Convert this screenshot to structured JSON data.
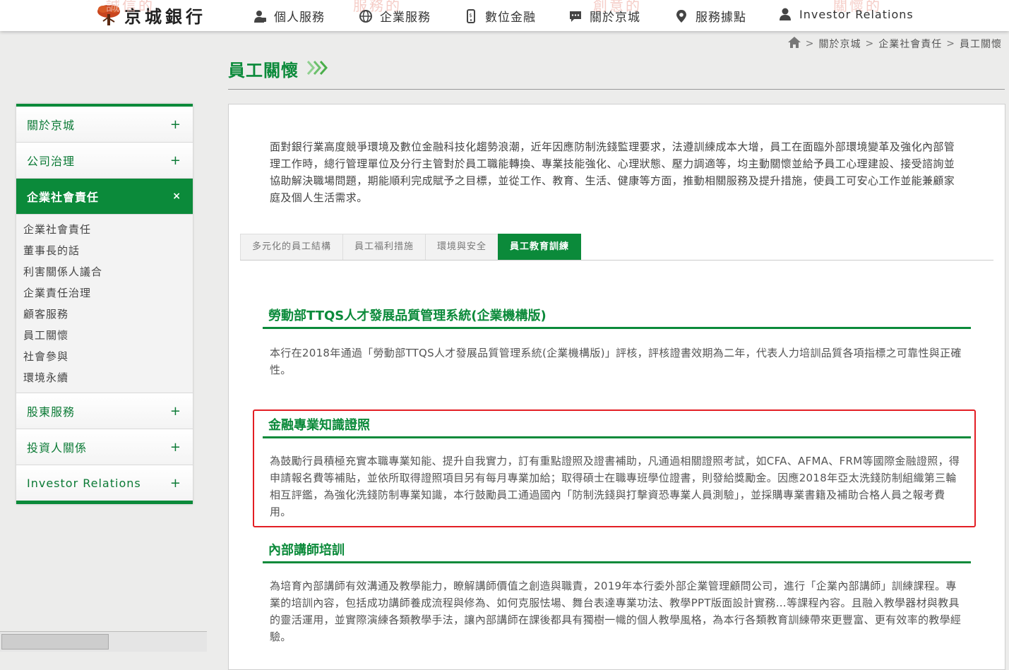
{
  "header": {
    "logo_text": "京城銀行",
    "nav": [
      {
        "label": "個人服務",
        "icon": "person-icon"
      },
      {
        "label": "企業服務",
        "icon": "globe-icon"
      },
      {
        "label": "數位金融",
        "icon": "phone-icon"
      },
      {
        "label": "關於京城",
        "icon": "chat-icon"
      },
      {
        "label": "服務據點",
        "icon": "location-pin-icon"
      },
      {
        "label": "Investor Relations",
        "icon": "user-icon"
      }
    ]
  },
  "breadcrumb": [
    "關於京城",
    "企業社會責任",
    "員工關懷"
  ],
  "page_title": "員工關懷",
  "sidebar": {
    "items": [
      {
        "label": "關於京城",
        "toggle": "+"
      },
      {
        "label": "公司治理",
        "toggle": "+"
      },
      {
        "label": "企業社會責任",
        "toggle": "×"
      },
      {
        "label": "股東服務",
        "toggle": "+"
      },
      {
        "label": "投資人關係",
        "toggle": "+"
      },
      {
        "label": "Investor Relations",
        "toggle": "+"
      }
    ],
    "submenu": [
      "企業社會責任",
      "董事長的話",
      "利害關係人議合",
      "企業責任治理",
      "顧客服務",
      "員工關懷",
      "社會參與",
      "環境永續"
    ]
  },
  "intro": "面對銀行業高度競爭環境及數位金融科技化趨勢浪潮，近年因應防制洗錢監理要求，法遵訓練成本大增，員工在面臨外部環境變革及強化內部管理工作時，總行管理單位及分行主管對於員工職能轉換、專業技能強化、心理狀態、壓力調適等，均主動關懷並給予員工心理建設、接受諮詢並協助解決職場問題，期能順利完成賦予之目標，並從工作、教育、生活、健康等方面，推動相關服務及提升措施，使員工可安心工作並能兼顧家庭及個人生活需求。",
  "tabs": [
    "多元化的員工結構",
    "員工福利措施",
    "環境與安全",
    "員工教育訓練"
  ],
  "sections": [
    {
      "title": "勞動部TTQS人才發展品質管理系統(企業機構版)",
      "body": "本行在2018年通過「勞動部TTQS人才發展品質管理系統(企業機構版)」評核，評核證書效期為二年，代表人力培訓品質各項指標之可靠性與正確性。"
    },
    {
      "title": "金融專業知識證照",
      "body": "為鼓勵行員積極充實本職專業知能、提升自我實力，訂有重點證照及證書補助，凡通過相關證照考試，如CFA、AFMA、FRM等國際金融證照，得申請報名費等補貼，並依所取得證照項目另有每月專業加給；取得碩士在職專班學位證書，則發給獎勵金。因應2018年亞太洗錢防制組織第三輪相互評鑑，為強化洗錢防制專業知識，本行鼓勵員工通過國內「防制洗錢與打擊資恐專業人員測驗」，並採購專業書籍及補助合格人員之報考費用。"
    },
    {
      "title": "內部講師培訓",
      "body": "為培育內部講師有效溝通及教學能力，瞭解講師價值之創造與職責，2019年本行委外部企業管理顧問公司，進行「企業內部講師」訓練課程。專業的培訓內容，包括成功講師養成流程與修為、如何克服怯場、舞台表達專業功法、教學PPT版面設計實務…等課程內容。且融入教學器材與教具的靈活運用，並實際演練各類教學手法，讓內部講師在課後都具有獨樹一幟的個人教學風格，為本行各類教育訓練帶來更豐富、更有效率的教學經驗。"
    }
  ],
  "colors": {
    "brand_green": "#0b8a3a",
    "highlight_red": "#e31e24"
  }
}
